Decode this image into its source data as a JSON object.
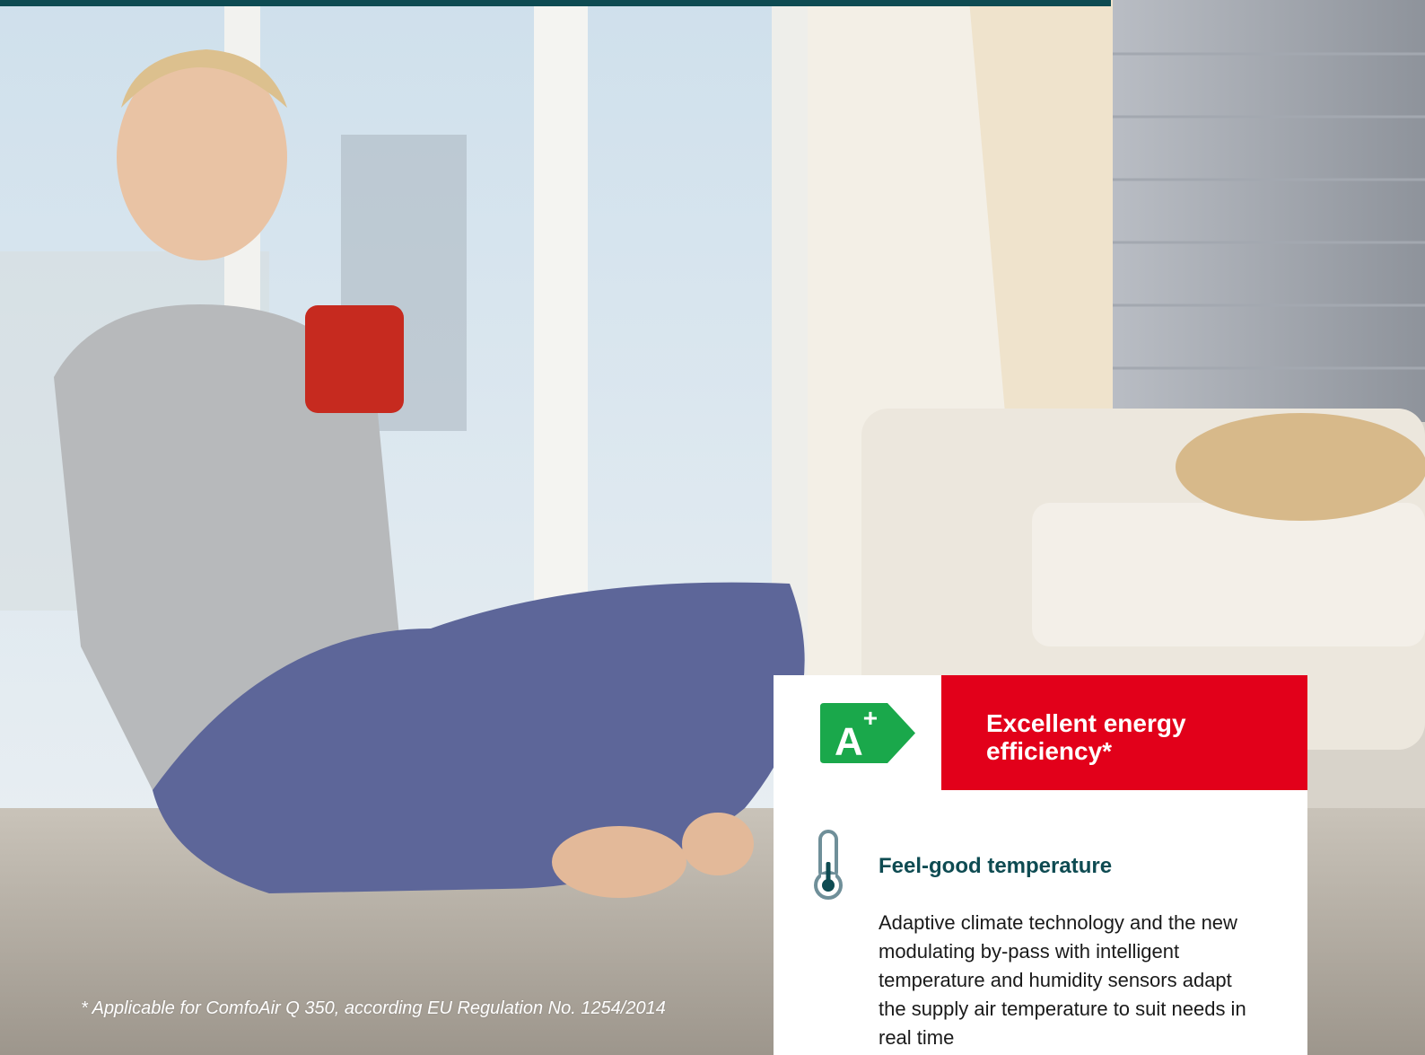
{
  "footnote": "* Applicable for ComfoAir Q 350, according EU Regulation No. 1254/2014",
  "badge": {
    "letter": "A",
    "superscript": "+",
    "color": "#1aa84b"
  },
  "headline": {
    "text": "Excellent energy efficiency*",
    "color": "#e2001a"
  },
  "feature": {
    "icon": "thermometer-icon",
    "title": "Feel-good temperature",
    "body": "Adaptive climate technology and the new modulating by-pass with intelligent temperature and humidity sensors adapt the supply air temperature to suit needs in real time"
  },
  "accent_color": "#0e4b52"
}
